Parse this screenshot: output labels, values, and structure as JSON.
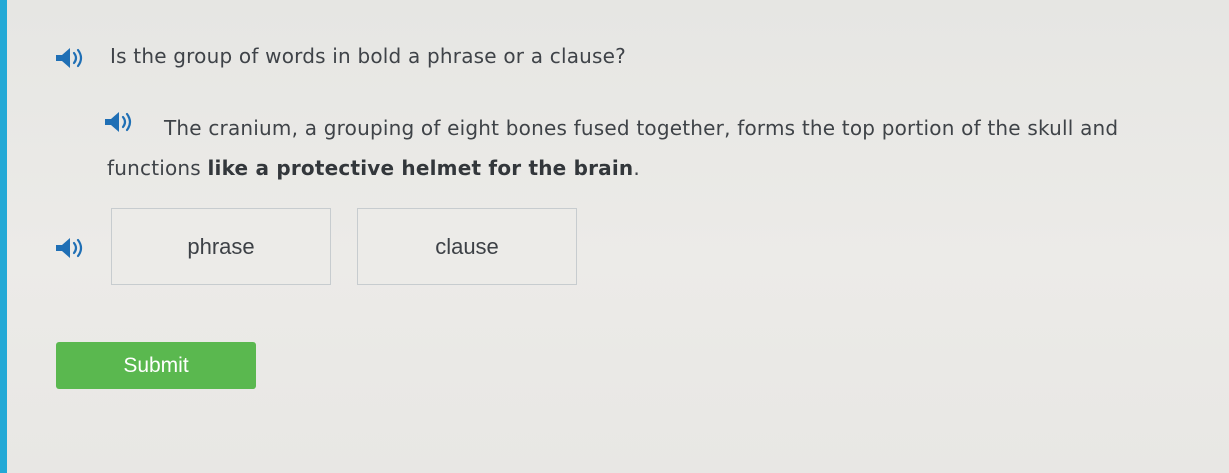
{
  "question": {
    "text": "Is the group of words in bold a phrase or a clause?"
  },
  "passage": {
    "before_bold": "The cranium, a grouping of eight bones fused together, forms the top portion of the skull and functions ",
    "bold": "like a protective helmet for the brain",
    "after_bold": "."
  },
  "choices": [
    {
      "label": "phrase"
    },
    {
      "label": "clause"
    }
  ],
  "submit": {
    "label": "Submit"
  },
  "icons": {
    "audio": "speaker-icon"
  },
  "colors": {
    "accent_bar": "#23a9d6",
    "speaker": "#1f6fb5",
    "submit_bg": "#5ab84f"
  }
}
